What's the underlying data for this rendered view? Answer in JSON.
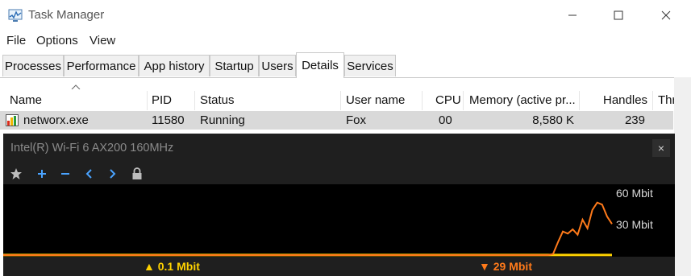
{
  "window": {
    "title": "Task Manager",
    "app_icon": "task-manager-icon"
  },
  "menu": [
    "File",
    "Options",
    "View"
  ],
  "tabs": [
    {
      "label": "Processes",
      "active": false
    },
    {
      "label": "Performance",
      "active": false
    },
    {
      "label": "App history",
      "active": false
    },
    {
      "label": "Startup",
      "active": false
    },
    {
      "label": "Users",
      "active": false
    },
    {
      "label": "Details",
      "active": true
    },
    {
      "label": "Services",
      "active": false
    }
  ],
  "columns": [
    "Name",
    "PID",
    "Status",
    "User name",
    "CPU",
    "Memory (active pr...",
    "Handles",
    "Thr"
  ],
  "rows": [
    {
      "name": "networx.exe",
      "pid": "11580",
      "status": "Running",
      "user": "Fox",
      "cpu": "00",
      "memory": "8,580 K",
      "handles": "239",
      "icon": "networx-bar-icon"
    }
  ],
  "overlay": {
    "title": "Intel(R) Wi-Fi 6 AX200 160MHz",
    "scale": {
      "top": "60 Mbit",
      "mid": "30 Mbit"
    },
    "upload": "0.1 Mbit",
    "download": "29 Mbit",
    "colors": {
      "upload": "#ffd200",
      "download": "#ff7a1a",
      "accent": "#4aa3ff"
    },
    "tools": [
      "star-icon",
      "plus-icon",
      "minus-icon",
      "chevron-left-icon",
      "chevron-right-icon",
      "lock-icon"
    ]
  },
  "chart_data": {
    "type": "line",
    "ylim": [
      0,
      60
    ],
    "series": [
      {
        "values": [
          0.1,
          0.1,
          0.1,
          0.1,
          0.1,
          0.1,
          0.1,
          0.1,
          0.1,
          0.1,
          0.1,
          0.1,
          0.1,
          0.1,
          0.1,
          0.1,
          0.1,
          0.1,
          0.1,
          0.1,
          0.1,
          0.1,
          0.1,
          0.1,
          0.1,
          0.1,
          0.1,
          0.1,
          0.1,
          0.1,
          0.1,
          0.1,
          0.1,
          0.1,
          0.1,
          0.1,
          0.1,
          0.1,
          0.1,
          0.1,
          0.1,
          0.1,
          0.1,
          0.1,
          0.1,
          0.1,
          0.1,
          0.1,
          0.1,
          0.1,
          0.1,
          0.1,
          0.1,
          0.1,
          0.1,
          0.1,
          0.1,
          0.1,
          0.1,
          0.1,
          0.1,
          0.1,
          0.1,
          0.1,
          0.1,
          0.1,
          0.1,
          0.1,
          0.1,
          0.1,
          0.1,
          0.1,
          0.1,
          0.1,
          0.1,
          0.1,
          0.1,
          0.1,
          0.1,
          0.1,
          0.1,
          0.1,
          0.1,
          0.1,
          0.1,
          0.1,
          0.1,
          0.1,
          0.1,
          0.1,
          0.1,
          0.1,
          0.1,
          0.1,
          0.1,
          0.1,
          0.1,
          0.1,
          0.1,
          0.1,
          0.1,
          0.1,
          0.1,
          0.1,
          0.1,
          0.1,
          0.1,
          0.1,
          0.1,
          0.1,
          0.1,
          0.1,
          0.1,
          0.1,
          0.1,
          0.1,
          0.1,
          0.1,
          0.1,
          0.1,
          0.1,
          0.1,
          0.1,
          0.1,
          0.1
        ],
        "color": "#ffd200"
      },
      {
        "values": [
          0,
          0,
          0,
          0,
          0,
          0,
          0,
          0,
          0,
          0,
          0,
          0,
          0,
          0,
          0,
          0,
          0,
          0,
          0,
          0,
          0,
          0,
          0,
          0,
          0,
          0,
          0,
          0,
          0,
          0,
          0,
          0,
          0,
          0,
          0,
          0,
          0,
          0,
          0,
          0,
          0,
          0,
          0,
          0,
          0,
          0,
          0,
          0,
          0,
          0,
          0,
          0,
          0,
          0,
          0,
          0,
          0,
          0,
          0,
          0,
          0,
          0,
          0,
          0,
          0,
          0,
          0,
          0,
          0,
          0,
          0,
          0,
          0,
          0,
          0,
          0,
          0,
          0,
          0,
          0,
          0,
          0,
          0,
          0,
          0,
          0,
          0,
          0,
          0,
          0,
          0,
          0,
          0,
          0,
          0,
          0,
          0,
          0,
          0,
          0,
          0,
          0,
          0,
          0,
          0,
          0,
          0,
          0,
          0,
          0,
          0,
          0,
          1,
          12,
          22,
          20,
          24,
          19,
          33,
          25,
          42,
          49,
          47,
          36,
          29
        ],
        "color": "#ff7a1a"
      }
    ]
  }
}
